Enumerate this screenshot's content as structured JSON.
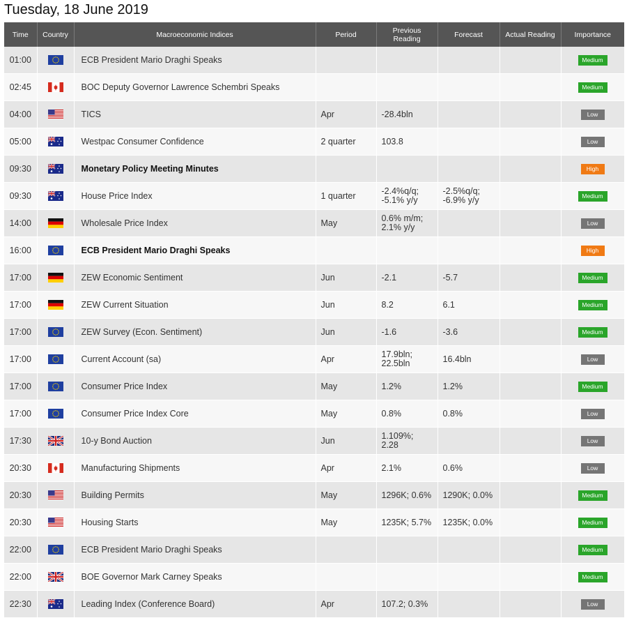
{
  "title": "Tuesday, 18 June 2019",
  "columns": [
    "Time",
    "Country",
    "Macroeconomic Indices",
    "Period",
    "Previous Reading",
    "Forecast",
    "Actual Reading",
    "Importance"
  ],
  "rows": [
    {
      "time": "01:00",
      "flag": "eu",
      "flag_icon": "eu-flag-icon",
      "indicator": "ECB President Mario Draghi Speaks",
      "bold": false,
      "period": "",
      "previous": "",
      "forecast": "",
      "actual": "",
      "importance": "Medium"
    },
    {
      "time": "02:45",
      "flag": "ca",
      "flag_icon": "canada-flag-icon",
      "indicator": "BOC Deputy Governor Lawrence Schembri Speaks",
      "bold": false,
      "period": "",
      "previous": "",
      "forecast": "",
      "actual": "",
      "importance": "Medium"
    },
    {
      "time": "04:00",
      "flag": "us",
      "flag_icon": "usa-flag-icon",
      "indicator": "TICS",
      "bold": false,
      "period": "Apr",
      "previous": "-28.4bln",
      "forecast": "",
      "actual": "",
      "importance": "Low"
    },
    {
      "time": "05:00",
      "flag": "au",
      "flag_icon": "australia-flag-icon",
      "indicator": "Westpac Consumer Confidence",
      "bold": false,
      "period": "2 quarter",
      "previous": "103.8",
      "forecast": "",
      "actual": "",
      "importance": "Low"
    },
    {
      "time": "09:30",
      "flag": "au",
      "flag_icon": "australia-flag-icon",
      "indicator": "Monetary Policy Meeting Minutes",
      "bold": true,
      "period": "",
      "previous": "",
      "forecast": "",
      "actual": "",
      "importance": "High"
    },
    {
      "time": "09:30",
      "flag": "au",
      "flag_icon": "australia-flag-icon",
      "indicator": "House Price Index",
      "bold": false,
      "period": "1 quarter",
      "previous": "-2.4%q/q;\n-5.1% y/y",
      "forecast": "-2.5%q/q;\n-6.9% y/y",
      "actual": "",
      "importance": "Medium"
    },
    {
      "time": "14:00",
      "flag": "de",
      "flag_icon": "germany-flag-icon",
      "indicator": "Wholesale Price Index",
      "bold": false,
      "period": "May",
      "previous": "0.6% m/m;\n2.1% y/y",
      "forecast": "",
      "actual": "",
      "importance": "Low"
    },
    {
      "time": "16:00",
      "flag": "eu",
      "flag_icon": "eu-flag-icon",
      "indicator": "ECB President Mario Draghi Speaks",
      "bold": true,
      "period": "",
      "previous": "",
      "forecast": "",
      "actual": "",
      "importance": "High"
    },
    {
      "time": "17:00",
      "flag": "de",
      "flag_icon": "germany-flag-icon",
      "indicator": "ZEW Economic Sentiment",
      "bold": false,
      "period": "Jun",
      "previous": "-2.1",
      "forecast": "-5.7",
      "actual": "",
      "importance": "Medium"
    },
    {
      "time": "17:00",
      "flag": "de",
      "flag_icon": "germany-flag-icon",
      "indicator": "ZEW Current Situation",
      "bold": false,
      "period": "Jun",
      "previous": "8.2",
      "forecast": "6.1",
      "actual": "",
      "importance": "Medium"
    },
    {
      "time": "17:00",
      "flag": "eu",
      "flag_icon": "eu-flag-icon",
      "indicator": "ZEW Survey (Econ. Sentiment)",
      "bold": false,
      "period": "Jun",
      "previous": "-1.6",
      "forecast": "-3.6",
      "actual": "",
      "importance": "Medium"
    },
    {
      "time": "17:00",
      "flag": "eu",
      "flag_icon": "eu-flag-icon",
      "indicator": "Current Account (sa)",
      "bold": false,
      "period": "Apr",
      "previous": "17.9bln;\n22.5bln",
      "forecast": "16.4bln",
      "actual": "",
      "importance": "Low"
    },
    {
      "time": "17:00",
      "flag": "eu",
      "flag_icon": "eu-flag-icon",
      "indicator": "Consumer Price Index",
      "bold": false,
      "period": "May",
      "previous": "1.2%",
      "forecast": "1.2%",
      "actual": "",
      "importance": "Medium"
    },
    {
      "time": "17:00",
      "flag": "eu",
      "flag_icon": "eu-flag-icon",
      "indicator": "Consumer Price Index Core",
      "bold": false,
      "period": "May",
      "previous": "0.8%",
      "forecast": "0.8%",
      "actual": "",
      "importance": "Low"
    },
    {
      "time": "17:30",
      "flag": "uk",
      "flag_icon": "uk-flag-icon",
      "indicator": "10-y Bond Auction",
      "bold": false,
      "period": "Jun",
      "previous": "1.109%;\n2.28",
      "forecast": "",
      "actual": "",
      "importance": "Low"
    },
    {
      "time": "20:30",
      "flag": "ca",
      "flag_icon": "canada-flag-icon",
      "indicator": "Manufacturing Shipments",
      "bold": false,
      "period": "Apr",
      "previous": "2.1%",
      "forecast": "0.6%",
      "actual": "",
      "importance": "Low"
    },
    {
      "time": "20:30",
      "flag": "us",
      "flag_icon": "usa-flag-icon",
      "indicator": "Building Permits",
      "bold": false,
      "period": "May",
      "previous": "1296K; 0.6%",
      "forecast": "1290K; 0.0%",
      "actual": "",
      "importance": "Medium"
    },
    {
      "time": "20:30",
      "flag": "us",
      "flag_icon": "usa-flag-icon",
      "indicator": "Housing Starts",
      "bold": false,
      "period": "May",
      "previous": "1235K; 5.7%",
      "forecast": "1235K; 0.0%",
      "actual": "",
      "importance": "Medium"
    },
    {
      "time": "22:00",
      "flag": "eu",
      "flag_icon": "eu-flag-icon",
      "indicator": "ECB President Mario Draghi Speaks",
      "bold": false,
      "period": "",
      "previous": "",
      "forecast": "",
      "actual": "",
      "importance": "Medium"
    },
    {
      "time": "22:00",
      "flag": "uk",
      "flag_icon": "uk-flag-icon",
      "indicator": "BOE Governor Mark Carney Speaks",
      "bold": false,
      "period": "",
      "previous": "",
      "forecast": "",
      "actual": "",
      "importance": "Medium"
    },
    {
      "time": "22:30",
      "flag": "au",
      "flag_icon": "australia-flag-icon",
      "indicator": "Leading Index (Conference Board)",
      "bold": false,
      "period": "Apr",
      "previous": "107.2; 0.3%",
      "forecast": "",
      "actual": "",
      "importance": "Low"
    }
  ],
  "colors": {
    "header_bg": "#555555",
    "row_odd": "#e6e6e6",
    "row_even": "#f7f7f7",
    "medium": "#2aa52a",
    "low": "#757575",
    "high": "#f07a14"
  }
}
